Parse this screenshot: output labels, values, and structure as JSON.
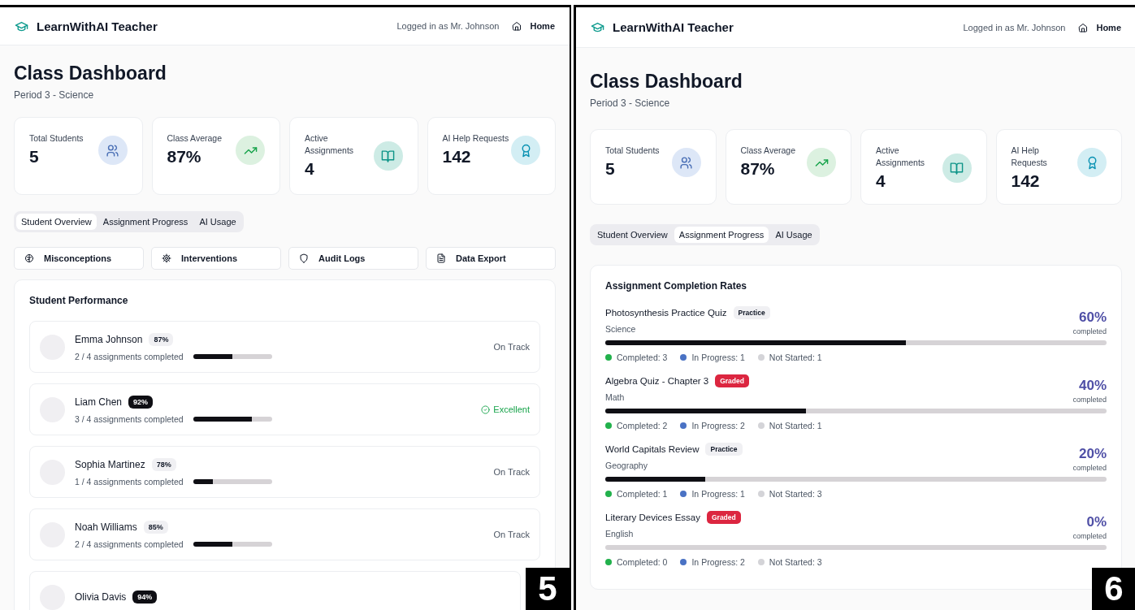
{
  "panels": [
    {
      "label": "5",
      "header": {
        "brand": "LearnWithAI Teacher",
        "user": "Logged in as Mr. Johnson",
        "home": "Home"
      },
      "title": "Class Dashboard",
      "subtitle": "Period 3 - Science",
      "stats": [
        {
          "label": "Total Students",
          "value": "5",
          "kind": "users"
        },
        {
          "label": "Class Average",
          "value": "87%",
          "kind": "trend"
        },
        {
          "label": "Active Assignments",
          "value": "4",
          "kind": "book"
        },
        {
          "label": "AI Help Requests",
          "value": "142",
          "kind": "award"
        }
      ],
      "tabs": [
        {
          "label": "Student Overview",
          "selected": true
        },
        {
          "label": "Assignment Progress",
          "selected": false
        },
        {
          "label": "AI Usage",
          "selected": false
        }
      ],
      "actions": [
        {
          "label": "Misconceptions",
          "kind": "brain"
        },
        {
          "label": "Interventions",
          "kind": "gear"
        },
        {
          "label": "Audit Logs",
          "kind": "shield"
        },
        {
          "label": "Data Export",
          "kind": "file"
        }
      ],
      "student_performance": {
        "title": "Student Performance",
        "students": [
          {
            "name": "Emma Johnson",
            "score": "87%",
            "highlight": false,
            "progress": "2 / 4 assignments completed",
            "level": 0.5,
            "status": "On Track",
            "kind": "on-track"
          },
          {
            "name": "Liam Chen",
            "score": "92%",
            "highlight": true,
            "progress": "3 / 4 assignments completed",
            "level": 0.75,
            "status": "Excellent",
            "kind": "excellent"
          },
          {
            "name": "Sophia Martinez",
            "score": "78%",
            "highlight": false,
            "progress": "1 / 4 assignments completed",
            "level": 0.25,
            "status": "On Track",
            "kind": "on-track"
          },
          {
            "name": "Noah Williams",
            "score": "85%",
            "highlight": false,
            "progress": "2 / 4 assignments completed",
            "level": 0.5,
            "status": "On Track",
            "kind": "on-track"
          },
          {
            "name": "Olivia Davis",
            "score": "94%",
            "highlight": true
          }
        ]
      }
    },
    {
      "label": "6",
      "header": {
        "brand": "LearnWithAI Teacher",
        "user": "Logged in as Mr. Johnson",
        "home": "Home"
      },
      "title": "Class Dashboard",
      "subtitle": "Period 3 - Science",
      "stats": [
        {
          "label": "Total Students",
          "value": "5",
          "kind": "users"
        },
        {
          "label": "Class Average",
          "value": "87%",
          "kind": "trend"
        },
        {
          "label": "Active Assignments",
          "value": "4",
          "kind": "book"
        },
        {
          "label": "AI Help Requests",
          "value": "142",
          "kind": "award"
        }
      ],
      "tabs": [
        {
          "label": "Student Overview",
          "selected": false
        },
        {
          "label": "Assignment Progress",
          "selected": true
        },
        {
          "label": "AI Usage",
          "selected": false
        }
      ],
      "assignment_completion": {
        "title": "Assignment Completion Rates",
        "assignments": [
          {
            "name": "Photosynthesis Practice Quiz",
            "tag": "Practice",
            "kind": "practice",
            "subject": "Science",
            "percent": "60%",
            "caption": "completed",
            "level": 0.6,
            "counts": [
              {
                "label": "Completed: 3",
                "color": "#22b14c"
              },
              {
                "label": "In Progress: 1",
                "color": "#4a72c4"
              },
              {
                "label": "Not Started: 1",
                "color": "#d4d4d8"
              }
            ]
          },
          {
            "name": "Algebra Quiz - Chapter 3",
            "tag": "Graded",
            "kind": "graded",
            "subject": "Math",
            "percent": "40%",
            "caption": "completed",
            "level": 0.4,
            "counts": [
              {
                "label": "Completed: 2",
                "color": "#22b14c"
              },
              {
                "label": "In Progress: 2",
                "color": "#4a72c4"
              },
              {
                "label": "Not Started: 1",
                "color": "#d4d4d8"
              }
            ]
          },
          {
            "name": "World Capitals Review",
            "tag": "Practice",
            "kind": "practice",
            "subject": "Geography",
            "percent": "20%",
            "caption": "completed",
            "level": 0.2,
            "counts": [
              {
                "label": "Completed: 1",
                "color": "#22b14c"
              },
              {
                "label": "In Progress: 1",
                "color": "#4a72c4"
              },
              {
                "label": "Not Started: 3",
                "color": "#d4d4d8"
              }
            ]
          },
          {
            "name": "Literary Devices Essay",
            "tag": "Graded",
            "kind": "graded",
            "subject": "English",
            "percent": "0%",
            "caption": "completed",
            "level": 0,
            "counts": [
              {
                "label": "Completed: 0",
                "color": "#22b14c"
              },
              {
                "label": "In Progress: 2",
                "color": "#4a72c4"
              },
              {
                "label": "Not Started: 3",
                "color": "#d4d4d8"
              }
            ]
          }
        ]
      }
    }
  ]
}
